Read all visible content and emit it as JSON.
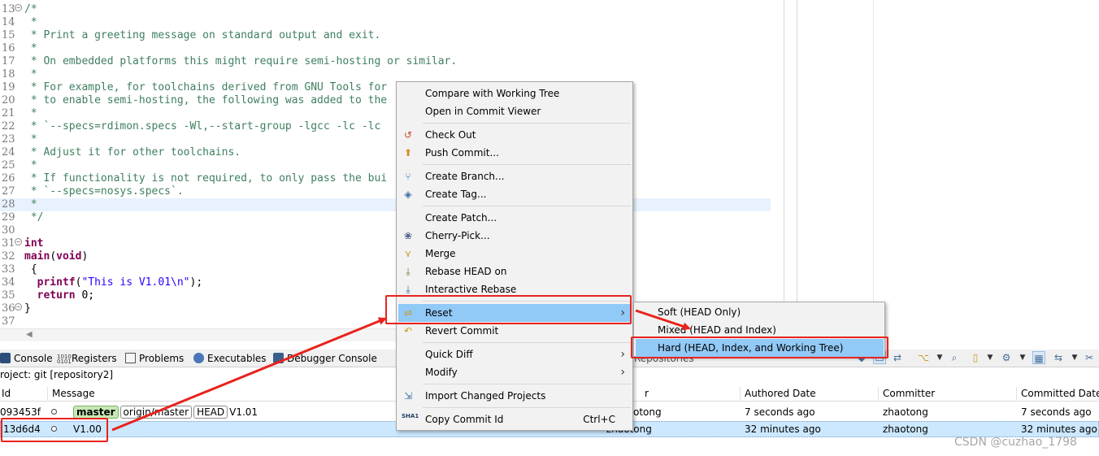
{
  "editor": {
    "lines": [
      {
        "n": "13",
        "fold": "−",
        "text": "/*",
        "cls": "cmt"
      },
      {
        "n": "14",
        "text": " *",
        "cls": "cmt"
      },
      {
        "n": "15",
        "text": " * Print a greeting message on standard output and exit.",
        "cls": "cmt"
      },
      {
        "n": "16",
        "text": " *",
        "cls": "cmt"
      },
      {
        "n": "17",
        "text": " * On embedded platforms this might require semi-hosting or similar.",
        "cls": "cmt"
      },
      {
        "n": "18",
        "text": " *",
        "cls": "cmt"
      },
      {
        "n": "19",
        "text": " * For example, for toolchains derived from GNU Tools for",
        "cls": "cmt"
      },
      {
        "n": "20",
        "text": " * to enable semi-hosting, the following was added to the",
        "cls": "cmt"
      },
      {
        "n": "21",
        "text": " *",
        "cls": "cmt"
      },
      {
        "n": "22",
        "text": " * `--specs=rdimon.specs -Wl,--start-group -lgcc -lc -lc",
        "cls": "cmt"
      },
      {
        "n": "23",
        "text": " *",
        "cls": "cmt"
      },
      {
        "n": "24",
        "text": " * Adjust it for other toolchains.",
        "cls": "cmt"
      },
      {
        "n": "25",
        "text": " *",
        "cls": "cmt"
      },
      {
        "n": "26",
        "text": " * If functionality is not required, to only pass the bui",
        "cls": "cmt"
      },
      {
        "n": "27",
        "text": " * `--specs=nosys.specs`.",
        "cls": "cmt"
      },
      {
        "n": "28",
        "text": " *",
        "cls": "cmt",
        "current": true
      },
      {
        "n": "29",
        "text": " */",
        "cls": "cmt"
      },
      {
        "n": "30",
        "text": "",
        "cls": ""
      },
      {
        "n": "31",
        "fold": "−",
        "text": "int",
        "cls": "kw"
      },
      {
        "n": "32",
        "text": "main(void)",
        "cls": "main"
      },
      {
        "n": "33",
        "text": " {",
        "cls": ""
      },
      {
        "n": "34",
        "text": "  printf(\"This is V1.01\\n\");",
        "cls": "printf"
      },
      {
        "n": "35",
        "text": "  return 0;",
        "cls": "return"
      },
      {
        "n": "36",
        "fold": "−",
        "text": "}",
        "cls": ""
      },
      {
        "n": "37",
        "text": "",
        "cls": ""
      }
    ],
    "printf_kw": "printf",
    "printf_open": "(",
    "printf_str": "\"This is V1.01\\n\"",
    "printf_close": ");",
    "main_kw": "main",
    "main_paren_open": "(",
    "void_kw": "void",
    "main_paren_close": ")",
    "return_kw": "return",
    "return_rest": " 0;"
  },
  "views": {
    "tabs": [
      {
        "label": "Console",
        "icon": "console-icon"
      },
      {
        "label": "Registers",
        "icon": "registers-icon"
      },
      {
        "label": "Problems",
        "icon": "problems-icon"
      },
      {
        "label": "Executables",
        "icon": "executables-icon"
      },
      {
        "label": "Debugger Console",
        "icon": "debugger-console-icon"
      }
    ],
    "partial_tab": "Repositories",
    "project_line": "roject: git [repository2]"
  },
  "history": {
    "columns": [
      "Id",
      "Message",
      "r",
      "Authored Date",
      "Committer",
      "Committed Date"
    ],
    "rows": [
      {
        "id": "093453f",
        "tags": [
          "master",
          "origin/master",
          "HEAD"
        ],
        "message": "V1.01",
        "author": "otong",
        "authored": "7 seconds ago",
        "committer": "zhaotong",
        "committed": "7 seconds ago",
        "selected": false
      },
      {
        "id": "13d6d4",
        "tags": [],
        "message": "V1.00",
        "author": "zhaotong",
        "authored": "32 minutes ago",
        "committer": "zhaotong",
        "committed": "32 minutes ago",
        "selected": true
      }
    ]
  },
  "menu": {
    "items": [
      {
        "label": "Compare with Working Tree",
        "icon": ""
      },
      {
        "label": "Open in Commit Viewer",
        "icon": ""
      },
      {
        "sep": true
      },
      {
        "label": "Check Out",
        "icon": "checkout-icon"
      },
      {
        "label": "Push Commit...",
        "icon": "push-icon"
      },
      {
        "sep": true
      },
      {
        "label": "Create Branch...",
        "icon": "branch-icon"
      },
      {
        "label": "Create Tag...",
        "icon": "tag-icon"
      },
      {
        "sep": true
      },
      {
        "label": "Create Patch...",
        "icon": ""
      },
      {
        "label": "Cherry-Pick...",
        "icon": "cherry-pick-icon"
      },
      {
        "label": "Merge",
        "icon": "merge-icon"
      },
      {
        "label": "Rebase HEAD on",
        "icon": "rebase-icon"
      },
      {
        "label": "Interactive Rebase",
        "icon": "interactive-rebase-icon"
      },
      {
        "sep": true
      },
      {
        "label": "Reset",
        "icon": "reset-icon",
        "submenu": true,
        "highlight": true
      },
      {
        "label": "Revert Commit",
        "icon": "revert-icon"
      },
      {
        "sep": true
      },
      {
        "label": "Quick Diff",
        "icon": "",
        "submenu": true
      },
      {
        "label": "Modify",
        "icon": "",
        "submenu": true
      },
      {
        "sep": true
      },
      {
        "label": "Import Changed Projects",
        "icon": "import-icon"
      },
      {
        "sep": true
      },
      {
        "label": "Copy Commit Id",
        "icon": "sha1-icon",
        "accel": "Ctrl+C"
      }
    ],
    "sha_icon_text": "SHA1"
  },
  "submenu": {
    "items": [
      {
        "label": "Soft (HEAD Only)"
      },
      {
        "label": "Mixed (HEAD and Index)"
      },
      {
        "label": "Hard (HEAD, Index, and Working Tree)",
        "highlight": true
      }
    ]
  },
  "watermark": "CSDN @cuzhao_1798",
  "colors": {
    "comment": "#3f7f5f",
    "keyword": "#7f0055",
    "string": "#2a00ff",
    "menu_highlight": "#91c9f7",
    "annotation_red": "#e8231d",
    "selected_row": "#cce8ff"
  }
}
